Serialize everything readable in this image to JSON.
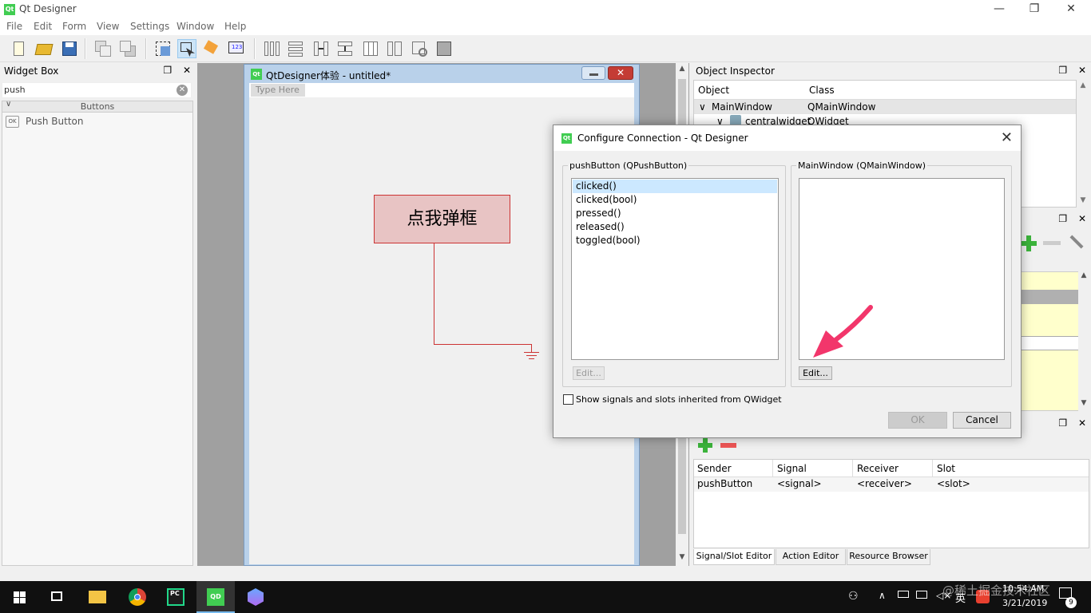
{
  "app": {
    "title": "Qt Designer",
    "logo_text": "Qt",
    "window_controls": {
      "minimize": "—",
      "restore": "❐",
      "close": "✕"
    }
  },
  "menu": [
    "File",
    "Edit",
    "Form",
    "View",
    "Settings",
    "Window",
    "Help"
  ],
  "toolbar": {
    "icons": [
      "new-file-icon",
      "open-folder-icon",
      "save-icon",
      "send-to-back-icon",
      "bring-to-front-icon",
      "edit-widgets-icon",
      "edit-signals-slots-icon",
      "edit-buddies-icon",
      "edit-tab-order-icon",
      "layout-horizontal-icon",
      "layout-vertical-icon",
      "layout-horizontal-splitter-icon",
      "layout-vertical-splitter-icon",
      "layout-grid-icon",
      "layout-form-icon",
      "break-layout-icon",
      "adjust-size-icon"
    ]
  },
  "widget_box": {
    "title": "Widget Box",
    "float_glyph": "❐",
    "close_glyph": "✕",
    "search_value": "push",
    "clear_glyph": "✕",
    "category": "Buttons",
    "category_chevron": "∨",
    "item": "Push Button",
    "item_icon_text": "OK"
  },
  "form_window": {
    "title": "QtDesigner体验 - untitled*",
    "logo_text": "Qt",
    "close_glyph": "✕",
    "menu_placeholder": "Type Here",
    "button_text": "点我弹框"
  },
  "object_inspector": {
    "title": "Object Inspector",
    "columns": [
      "Object",
      "Class"
    ],
    "rows": [
      {
        "object": "MainWindow",
        "class": "QMainWindow",
        "chevron": "∨"
      },
      {
        "object": "centralwidget",
        "class": "QWidget",
        "chevron": "∨"
      }
    ]
  },
  "signal_slot_editor": {
    "columns": [
      "Sender",
      "Signal",
      "Receiver",
      "Slot"
    ],
    "rows": [
      {
        "sender": "pushButton",
        "signal": "<signal>",
        "receiver": "<receiver>",
        "slot": "<slot>"
      }
    ],
    "tabs": [
      "Signal/Slot Editor",
      "Action Editor",
      "Resource Browser"
    ]
  },
  "dialog": {
    "title": "Configure Connection - Qt Designer",
    "logo_text": "Qt",
    "close_glyph": "✕",
    "left_group_title": "pushButton (QPushButton)",
    "right_group_title": "MainWindow (QMainWindow)",
    "signals": [
      "clicked()",
      "clicked(bool)",
      "pressed()",
      "released()",
      "toggled(bool)"
    ],
    "selected_signal": "clicked()",
    "left_edit_label": "Edit...",
    "right_edit_label": "Edit...",
    "checkbox_label": "Show signals and slots inherited from QWidget",
    "checkbox_checked": false,
    "ok_label": "OK",
    "cancel_label": "Cancel"
  },
  "taskbar": {
    "apps": [
      "windows-start-icon",
      "task-view-icon",
      "file-explorer-icon",
      "chrome-icon",
      "pycharm-icon",
      "qt-designer-icon",
      "app-icon"
    ],
    "pycharm_text": "PC",
    "qt_text": "QD",
    "ime_label": "英",
    "time": "10:54 AM",
    "date": "3/21/2019",
    "notification_count": "9",
    "watermark": "@稀土掘金技术社区"
  },
  "colors": {
    "qt_green": "#41cd52",
    "connection_red": "#cc3333",
    "annotation_arrow": "#f2366b",
    "selection": "#cce8ff"
  }
}
